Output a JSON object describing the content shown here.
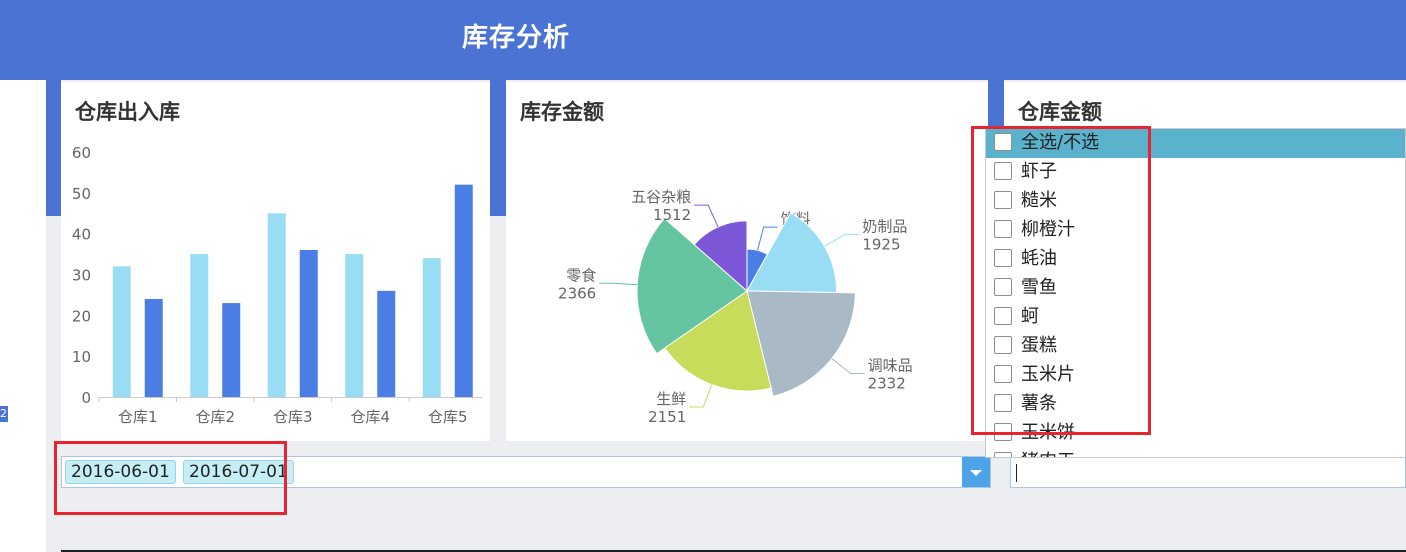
{
  "header": {
    "title": "库存分析"
  },
  "left_badge": "2",
  "panels": {
    "bar": {
      "title": "仓库出入库"
    },
    "pie": {
      "title": "库存金额"
    },
    "right": {
      "title": "仓库金额"
    }
  },
  "chart_data": [
    {
      "type": "bar",
      "title": "仓库出入库",
      "categories": [
        "仓库1",
        "仓库2",
        "仓库3",
        "仓库4",
        "仓库5"
      ],
      "series": [
        {
          "values": [
            32,
            35,
            45,
            35,
            34
          ],
          "color": "#99ddf5"
        },
        {
          "values": [
            24,
            23,
            36,
            26,
            52
          ],
          "color": "#4a7ee4"
        }
      ],
      "ylim": [
        0,
        60
      ],
      "yticks": [
        0,
        10,
        20,
        30,
        40,
        50,
        60
      ],
      "grid": false
    },
    {
      "type": "pie",
      "title": "库存金额",
      "rose_type": "radius",
      "slices": [
        {
          "label": "饮料",
          "value": 904,
          "color": "#4a7ee4"
        },
        {
          "label": "奶制品",
          "value": 1925,
          "color": "#99ddf5"
        },
        {
          "label": "调味品",
          "value": 2332,
          "color": "#a9b9c6"
        },
        {
          "label": "生鲜",
          "value": 2151,
          "color": "#c6dc5a"
        },
        {
          "label": "零食",
          "value": 2366,
          "color": "#66c5a1"
        },
        {
          "label": "五谷杂粮",
          "value": 1512,
          "color": "#7c58d8"
        }
      ]
    }
  ],
  "date_filter": {
    "tags": [
      "2016-06-01",
      "2016-07-01"
    ]
  },
  "dropdown": {
    "items": [
      "全选/不选",
      "虾子",
      "糙米",
      "柳橙汁",
      "蚝油",
      "雪鱼",
      "蚵",
      "蛋糕",
      "玉米片",
      "薯条",
      "玉米饼",
      "猪肉干"
    ],
    "selected_index": 0
  },
  "colors": {
    "header": "#4a73d3",
    "highlight": "#e8252e",
    "selected_row": "#5bb2cc"
  }
}
